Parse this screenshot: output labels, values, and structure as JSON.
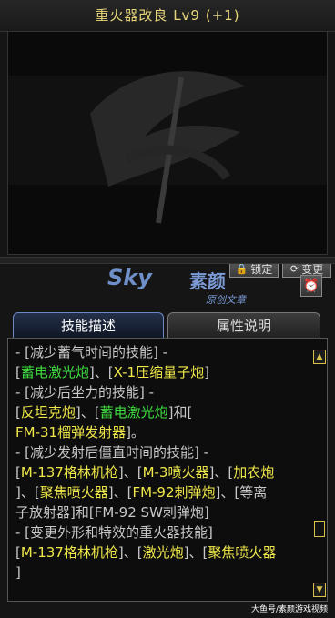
{
  "title": "重火器改良 Lv9 (+1)",
  "buttons": {
    "lock_label": "锁定",
    "change_label": "变更",
    "lock_icon": "lock-icon",
    "change_icon": "refresh-icon",
    "alarm_icon": "alarm-clock-icon"
  },
  "watermark": {
    "sky": "Sky",
    "name": "素颜",
    "subtitle": "原创文章"
  },
  "tabs": [
    {
      "label": "技能描述",
      "active": true
    },
    {
      "label": "属性说明",
      "active": false
    }
  ],
  "description_lines": [
    [
      {
        "t": "- [减少蓄气时间的技能] -",
        "c": "w"
      }
    ],
    [
      {
        "t": "[",
        "c": "w"
      },
      {
        "t": "蓄电激光炮",
        "c": "g"
      },
      {
        "t": "]、[",
        "c": "w"
      },
      {
        "t": "X-1压缩量子炮",
        "c": "y"
      },
      {
        "t": "]",
        "c": "w"
      }
    ],
    [
      {
        "t": "- [减少后坐力的技能] -",
        "c": "w"
      }
    ],
    [
      {
        "t": "[",
        "c": "w"
      },
      {
        "t": "反坦克炮",
        "c": "y"
      },
      {
        "t": "]、[",
        "c": "w"
      },
      {
        "t": "蓄电激光炮",
        "c": "g"
      },
      {
        "t": "]和[",
        "c": "w"
      }
    ],
    [
      {
        "t": "FM-31榴弹发射器",
        "c": "y"
      },
      {
        "t": "]。",
        "c": "w"
      }
    ],
    [
      {
        "t": "- [减少发射后僵直时间的技能] -",
        "c": "w"
      }
    ],
    [
      {
        "t": "[",
        "c": "w"
      },
      {
        "t": "M-137格林机枪",
        "c": "y"
      },
      {
        "t": "]、[",
        "c": "w"
      },
      {
        "t": "M-3喷火器",
        "c": "y"
      },
      {
        "t": "]、[",
        "c": "w"
      },
      {
        "t": "加农炮",
        "c": "y"
      }
    ],
    [
      {
        "t": "]、[",
        "c": "w"
      },
      {
        "t": "聚焦喷火器",
        "c": "y"
      },
      {
        "t": "]、[",
        "c": "w"
      },
      {
        "t": "FM-92刺弹炮",
        "c": "y"
      },
      {
        "t": "]、[等离",
        "c": "w"
      }
    ],
    [
      {
        "t": "子放射器]和[FM-92 SW刺弹炮]",
        "c": "w"
      }
    ],
    [
      {
        "t": "- [变更外形和特效的重火器技能]",
        "c": "w"
      }
    ],
    [
      {
        "t": "[",
        "c": "w"
      },
      {
        "t": "M-137格林机枪",
        "c": "y"
      },
      {
        "t": "]、[",
        "c": "w"
      },
      {
        "t": "激光炮",
        "c": "y"
      },
      {
        "t": "]、[",
        "c": "w"
      },
      {
        "t": "聚焦喷火器",
        "c": "y"
      }
    ],
    [
      {
        "t": "]",
        "c": "w"
      }
    ]
  ],
  "scroll": {
    "up_icon": "scroll-up-arrow-icon",
    "down_icon": "scroll-down-arrow-icon"
  },
  "footer_watermark": "大鱼号/素颜游戏视频"
}
